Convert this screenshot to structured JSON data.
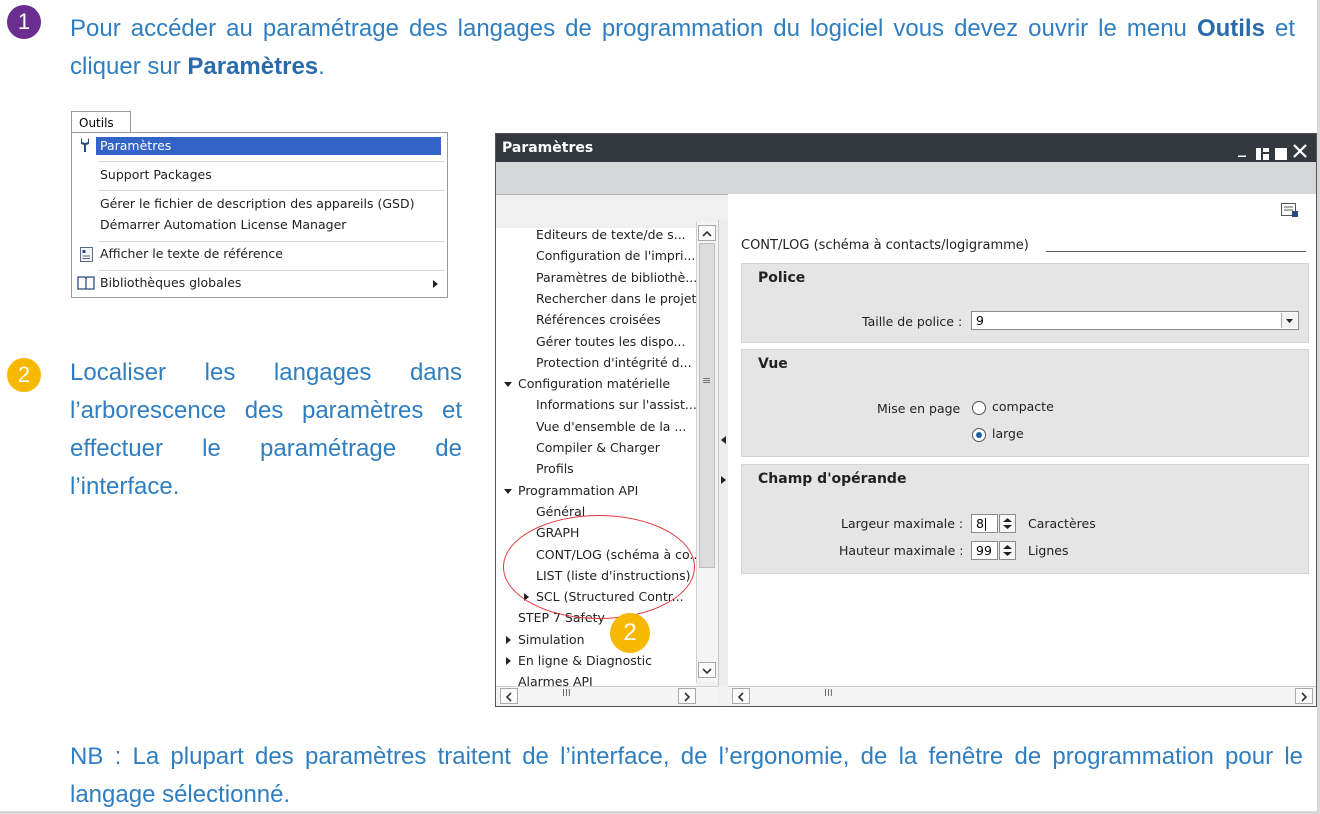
{
  "steps": {
    "step1_num": "1",
    "step1_text_a": "Pour accéder au paramétrage des langages de programmation du logiciel vous devez ouvrir le menu ",
    "step1_bold_a": "Outils",
    "step1_text_b": " et cliquer sur ",
    "step1_bold_b": "Paramètres",
    "step1_text_c": ".",
    "step2_num": "2",
    "step2_text": "Localiser les langages dans l’arborescence des paramètres et effectuer le paramétrage de l’interface.",
    "note": "NB : La plupart des paramètres traitent de l’interface, de l’ergonomie, de la fenêtre de programmation pour le langage sélectionné.",
    "tree_badge_num": "2"
  },
  "menu": {
    "title": "Outils",
    "items": [
      "Paramètres",
      "Support Packages",
      "Gérer le fichier de description des appareils (GSD)",
      "Démarrer Automation License Manager",
      "Afficher le texte de référence",
      "Bibliothèques globales"
    ]
  },
  "window": {
    "title": "Paramètres",
    "controls": [
      "_",
      "▮",
      "■",
      "✕"
    ]
  },
  "tree": {
    "items": [
      "Editeurs de texte/de s...",
      "Configuration de l'impri...",
      "Paramètres de bibliothè...",
      "Rechercher dans le projet",
      "Références croisées",
      "Gérer toutes les dispo...",
      "Protection d'intégrité d...",
      "Configuration matérielle",
      "Informations sur l'assist...",
      "Vue d'ensemble de la ...",
      "Compiler & Charger",
      "Profils",
      "Programmation API",
      "Général",
      "GRAPH",
      "CONT/LOG (schéma à co...",
      "LIST (liste d'instructions)",
      "SCL (Structured Contr...",
      "STEP 7 Safety",
      "Simulation",
      "En ligne & Diagnostic",
      "Alarmes API"
    ]
  },
  "panel": {
    "heading": "CONT/LOG (schéma à contacts/logigramme)",
    "police": {
      "title": "Police",
      "font_size_label": "Taille de police :",
      "font_size_value": "9"
    },
    "vue": {
      "title": "Vue",
      "layout_label": "Mise en page",
      "opt_compact": "compacte",
      "opt_large": "large",
      "selected": "large"
    },
    "operand": {
      "title": "Champ d'opérande",
      "max_width_label": "Largeur maximale :",
      "max_width_value": "8",
      "max_width_unit": "Caractères",
      "max_height_label": "Hauteur maximale :",
      "max_height_value": "99",
      "max_height_unit": "Lignes"
    }
  },
  "scroll": {
    "thumb": "III",
    "grip": "≡"
  },
  "colors": {
    "text_blue": "#2f7ec1",
    "step1_badge": "#6a2e91",
    "step2_badge": "#f7b800",
    "highlight_circle": "#e23a3a",
    "menu_selection": "#3264c8",
    "titlebar": "#33393e"
  }
}
